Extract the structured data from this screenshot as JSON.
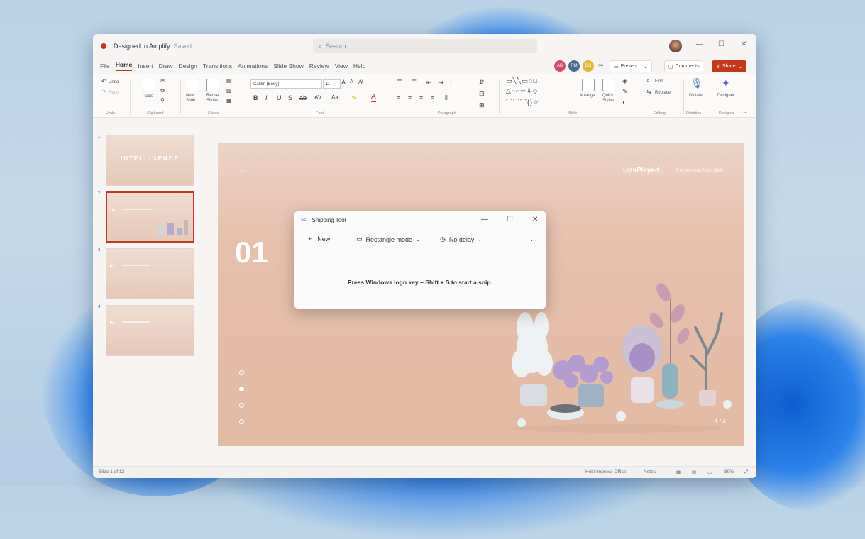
{
  "window": {
    "title": "Designed to Amplify",
    "saved": "Saved",
    "search_placeholder": "Search"
  },
  "menu": [
    "File",
    "Home",
    "Insert",
    "Draw",
    "Design",
    "Transitions",
    "Animations",
    "Slide Show",
    "Review",
    "View",
    "Help"
  ],
  "collaborators": [
    {
      "initials": "AB",
      "color": "#d14c6b"
    },
    {
      "initials": "RM",
      "color": "#4b6b8f"
    },
    {
      "initials": "DC",
      "color": "#e0b93a"
    }
  ],
  "collab_more": "+4",
  "actions": {
    "present": "Present",
    "comments": "Comments",
    "share": "Share"
  },
  "ribbon": {
    "undo": "Undo",
    "redo": "Redo",
    "paste": "Paste",
    "new_slide": "New Slide",
    "reuse_slides": "Reuse Slides",
    "font_name": "Calibri (Body)",
    "font_size": "11",
    "arrange": "Arrange",
    "quick_styles": "Quick Styles",
    "find": "Find",
    "replace": "Replace",
    "dictate": "Dictate",
    "designer": "Designer",
    "groups": [
      "Undo",
      "Clipboard",
      "Slides",
      "Font",
      "Paragraph",
      "Style",
      "Editing",
      "Dictation",
      "Designer"
    ]
  },
  "thumbnails": [
    {
      "num": "1",
      "text": "INTELLIGENCE",
      "selected": false
    },
    {
      "num": "2",
      "text": "01",
      "selected": true
    },
    {
      "num": "3",
      "text": "02",
      "selected": false
    },
    {
      "num": "4",
      "text": "03",
      "selected": false
    }
  ],
  "slide": {
    "number": "01",
    "logo": "UpsPlayed",
    "subtitle": "For Internal Use Only",
    "arrows": "‹ ›",
    "page": "1 / 4"
  },
  "snipping_tool": {
    "title": "Snipping Tool",
    "new": "New",
    "mode": "Rectangle mode",
    "delay": "No delay",
    "message": "Press Windows logo key + Shift + S to start a snip."
  },
  "status": {
    "slide_of": "Slide 1 of 12",
    "feedback": "Help Improve Office",
    "notes": "Notes",
    "zoom": "80%"
  }
}
